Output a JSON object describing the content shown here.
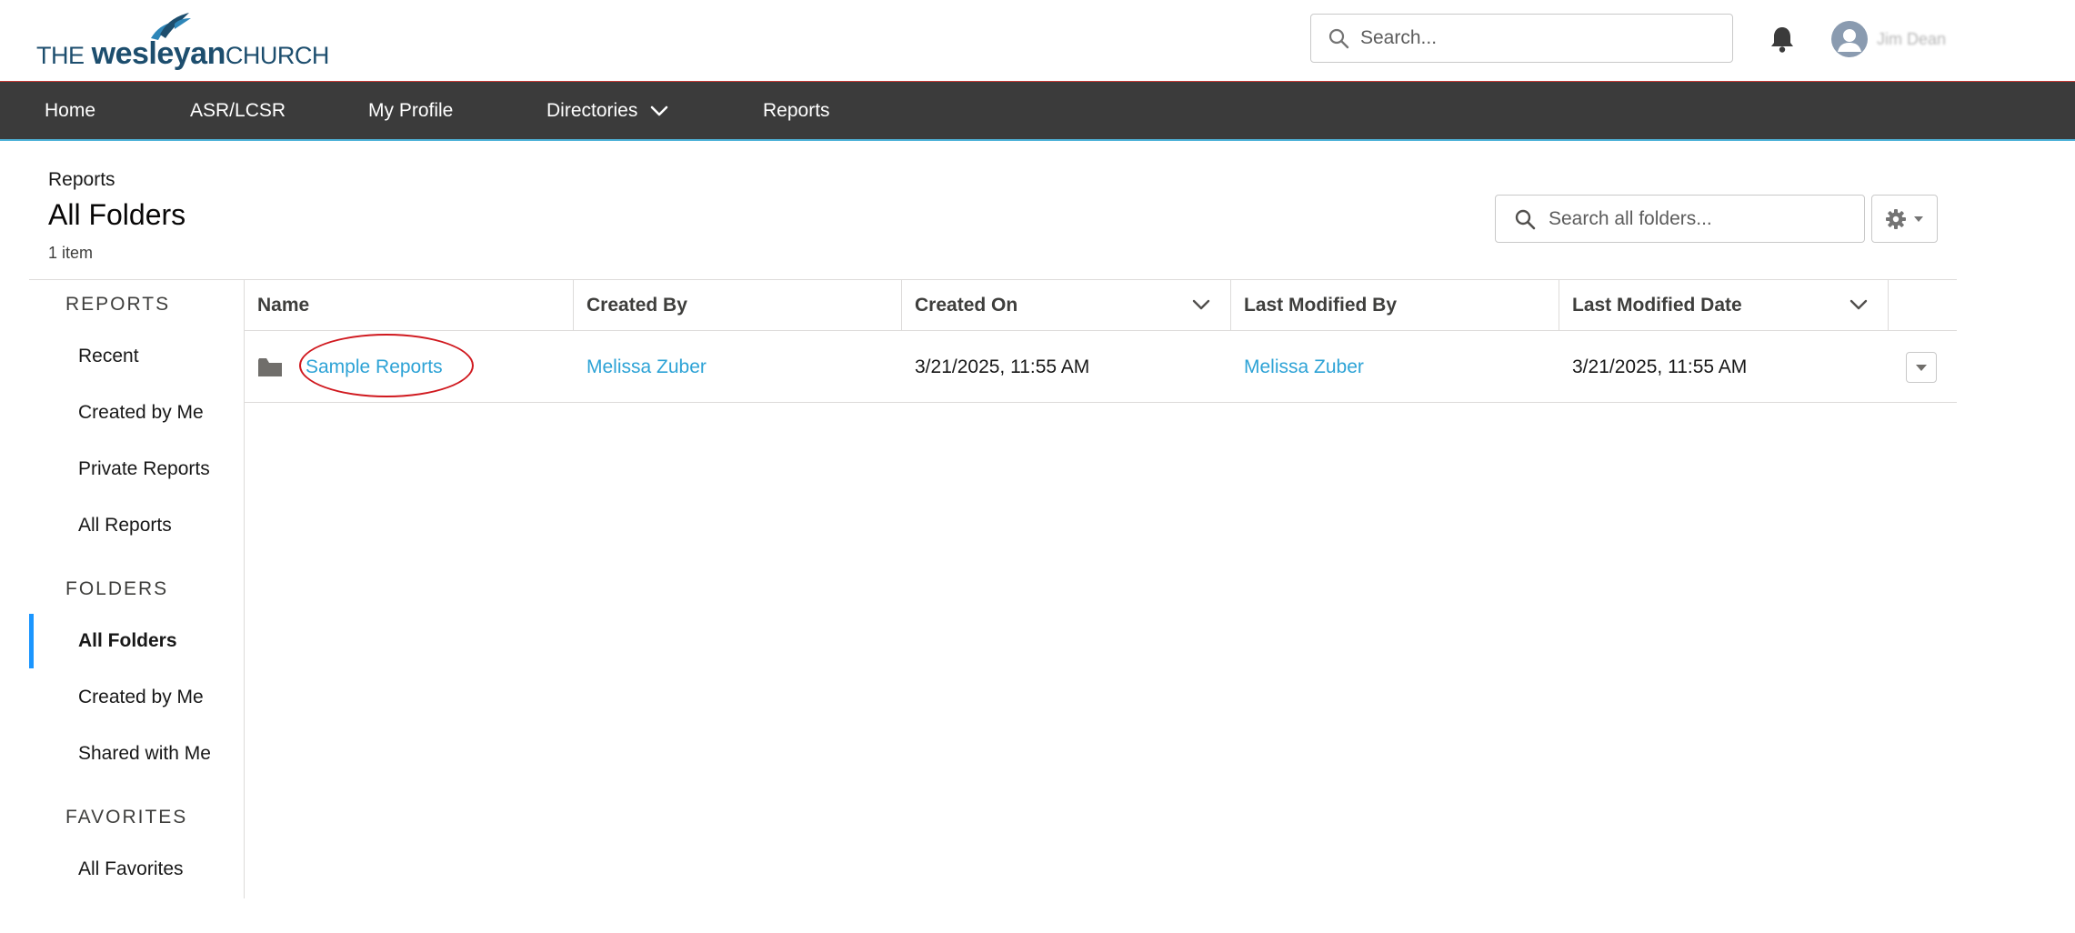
{
  "header": {
    "logo": {
      "the": "THE",
      "wesleyan": "wesleyan",
      "church": "CHURCH"
    },
    "search_placeholder": "Search...",
    "user_name": "Jim Dean"
  },
  "nav": {
    "items": [
      {
        "label": "Home"
      },
      {
        "label": "ASR/LCSR"
      },
      {
        "label": "My Profile"
      },
      {
        "label": "Directories"
      },
      {
        "label": "Reports"
      }
    ]
  },
  "page_header": {
    "breadcrumb": "Reports",
    "title": "All Folders",
    "item_count": "1 item",
    "search_placeholder": "Search all folders..."
  },
  "sidebar": {
    "reports_heading": "REPORTS",
    "reports_items": [
      {
        "label": "Recent"
      },
      {
        "label": "Created by Me"
      },
      {
        "label": "Private Reports"
      },
      {
        "label": "All Reports"
      }
    ],
    "folders_heading": "FOLDERS",
    "folders_items": [
      {
        "label": "All Folders",
        "active": true
      },
      {
        "label": "Created by Me"
      },
      {
        "label": "Shared with Me"
      }
    ],
    "favorites_heading": "FAVORITES",
    "favorites_items": [
      {
        "label": "All Favorites"
      }
    ]
  },
  "table": {
    "columns": [
      {
        "label": "Name"
      },
      {
        "label": "Created By"
      },
      {
        "label": "Created On"
      },
      {
        "label": "Last Modified By"
      },
      {
        "label": "Last Modified Date"
      }
    ],
    "rows": [
      {
        "name": "Sample Reports",
        "created_by": "Melissa Zuber",
        "created_on": "3/21/2025, 11:55 AM",
        "last_modified_by": "Melissa Zuber",
        "last_modified_date": "3/21/2025, 11:55 AM"
      }
    ]
  },
  "colors": {
    "nav_bg": "#3b3b3b",
    "link": "#2ea3d6",
    "active_accent": "#1b96ff",
    "highlight": "#d0191f",
    "brand": "#1d4e6e"
  },
  "icons": [
    "search-icon",
    "bell-icon",
    "user-avatar-icon",
    "chevron-down-icon",
    "gear-icon",
    "folder-icon",
    "caret-down-icon"
  ]
}
